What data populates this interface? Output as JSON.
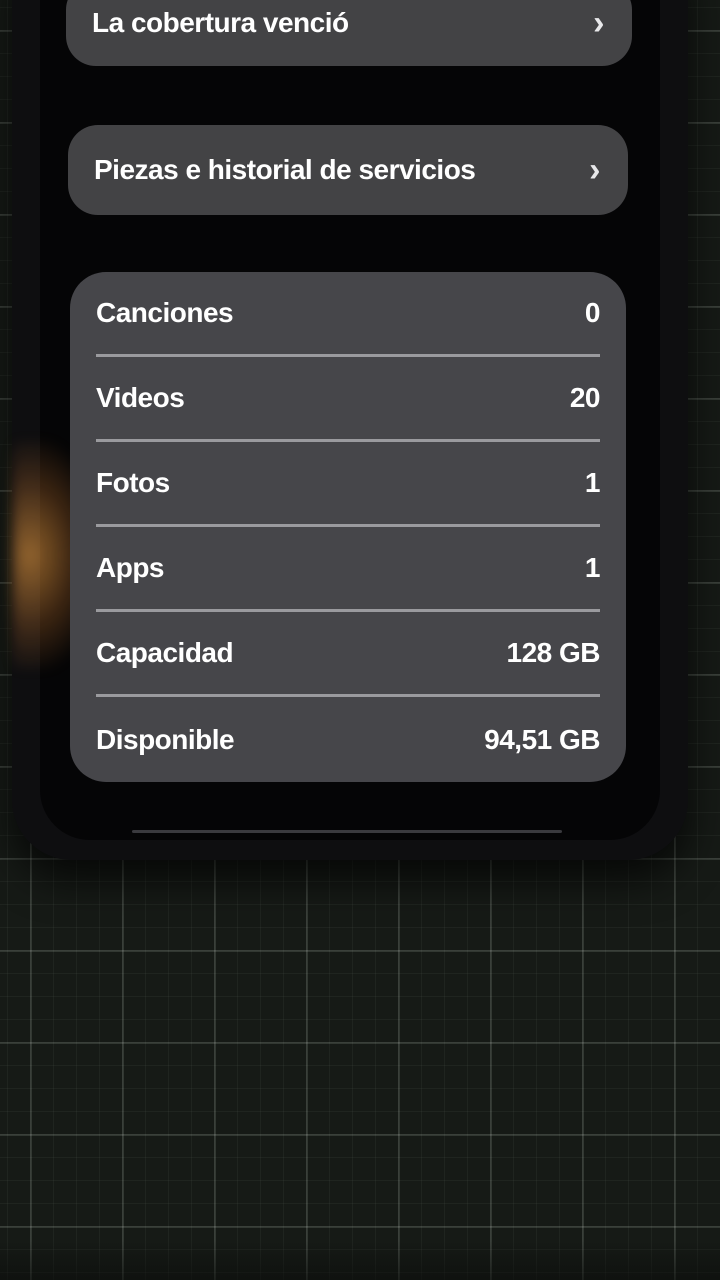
{
  "menu": {
    "coverage_label": "La cobertura venció",
    "parts_label": "Piezas e historial de servicios",
    "chevron": "›"
  },
  "stats": [
    {
      "label": "Canciones",
      "value": "0"
    },
    {
      "label": "Videos",
      "value": "20"
    },
    {
      "label": "Fotos",
      "value": "1"
    },
    {
      "label": "Apps",
      "value": "1"
    },
    {
      "label": "Capacidad",
      "value": "128 GB"
    },
    {
      "label": "Disponible",
      "value": "94,51 GB"
    }
  ],
  "colors": {
    "row_background": "#434345",
    "text": "#ffffff",
    "separator": "#9a9a9e"
  }
}
